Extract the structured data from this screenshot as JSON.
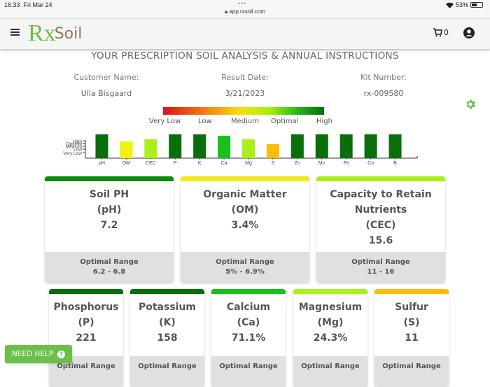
{
  "status_bar": {
    "time": "16:33",
    "date": "Fri Mar 24",
    "url": "app.rxsoil.com",
    "battery": "53%",
    "battery_fraction": 0.53
  },
  "navbar": {
    "logo_rx": "Rx",
    "logo_soil": "Soil",
    "cart_count": "0"
  },
  "page": {
    "title": "YOUR PRESCRIPTION SOIL ANALYSIS & ANNUAL INSTRUCTIONS",
    "customer_label": "Customer Name:",
    "customer_value": "Ulla Bisgaard",
    "date_label": "Result Date:",
    "date_value": "3/21/2023",
    "kit_label": "Kit Number:",
    "kit_value": "rx-009580"
  },
  "legend": {
    "labels": [
      "Very Low",
      "Low",
      "Medium",
      "Optimal",
      "High"
    ],
    "colors": [
      "#e0101a",
      "#f07a14",
      "#f4e10e",
      "#22b41a",
      "#086e0c"
    ]
  },
  "chart_data": {
    "type": "bar",
    "title": "",
    "xlabel": "",
    "ylabel": "",
    "categories": [
      "pH",
      "OM",
      "CEC",
      "P",
      "K",
      "Ca",
      "Mg",
      "S",
      "Zn",
      "Mn",
      "Fe",
      "Cu",
      "B"
    ],
    "values": [
      100,
      70,
      79,
      100,
      100,
      94,
      79,
      59,
      100,
      100,
      100,
      100,
      100
    ],
    "colors": [
      "#0a6e0c",
      "#f2f20a",
      "#aaf018",
      "#0a6e0c",
      "#0a6e0c",
      "#18c01e",
      "#aaf018",
      "#fdbd06",
      "#0a6e0c",
      "#0a6e0c",
      "#0a6e0c",
      "#0a6e0c",
      "#0a6e0c"
    ],
    "y_ticks": [
      {
        "label": "Very Low",
        "value": 22
      },
      {
        "label": "Low",
        "value": 38
      },
      {
        "label": "Medium",
        "value": 50
      },
      {
        "label": "Optimal",
        "value": 62
      },
      {
        "label": "High",
        "value": 72
      }
    ],
    "ylim": [
      0,
      100
    ],
    "grid": false
  },
  "cards_row1": [
    {
      "title": "Soil PH",
      "abbr": "(pH)",
      "value": "7.2",
      "range_label": "Optimal Range",
      "range": "6.2 - 6.8",
      "color": "#0c8a0e"
    },
    {
      "title": "Organic Matter",
      "abbr": "(OM)",
      "value": "3.4%",
      "range_label": "Optimal Range",
      "range": "5% - 6.9%",
      "color": "#f2ea14"
    },
    {
      "title": "Capacity to Retain Nutrients",
      "abbr": "(CEC)",
      "value": "15.6",
      "range_label": "Optimal Range",
      "range": "11 - 16",
      "color": "#aaf018"
    }
  ],
  "cards_row2": [
    {
      "title": "Phosphorus",
      "abbr": "(P)",
      "value": "221",
      "range_label": "Optimal Range",
      "color": "#0a6e0c"
    },
    {
      "title": "Potassium",
      "abbr": "(K)",
      "value": "158",
      "range_label": "Optimal Range",
      "color": "#0a6e0c"
    },
    {
      "title": "Calcium",
      "abbr": "(Ca)",
      "value": "71.1%",
      "range_label": "Optimal Range",
      "color": "#18c01e"
    },
    {
      "title": "Magnesium",
      "abbr": "(Mg)",
      "value": "24.3%",
      "range_label": "Optimal Range",
      "color": "#aaf018"
    },
    {
      "title": "Sulfur",
      "abbr": "(S)",
      "value": "11",
      "range_label": "Optimal Range",
      "color": "#fdbd06"
    }
  ],
  "help_button": {
    "label": "NEED HELP"
  }
}
